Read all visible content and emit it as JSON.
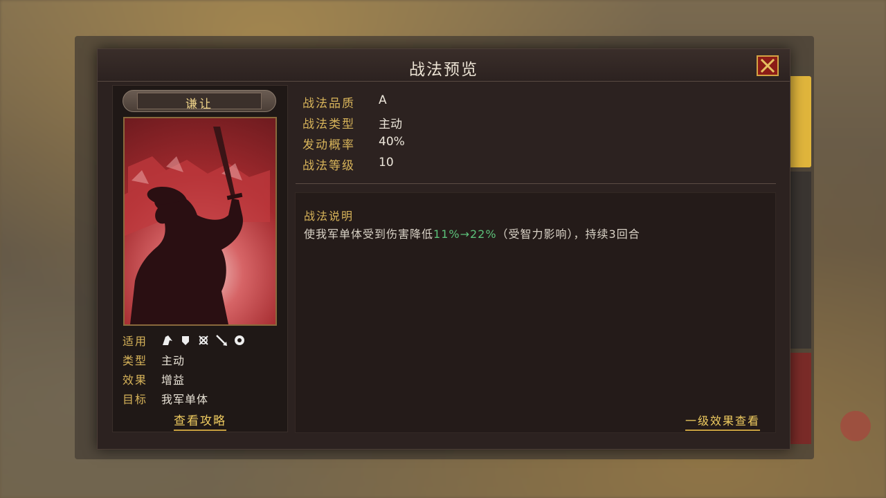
{
  "dialog": {
    "title": "战法预览"
  },
  "skill": {
    "name": "谦让",
    "portrait_icon": "warrior-silhouette-with-sword"
  },
  "left_info": {
    "applicable_label": "适用",
    "applicable_icons": [
      "cavalry-icon",
      "shield-icon",
      "crossbow-icon",
      "spear-icon",
      "siege-icon"
    ],
    "type_label": "类型",
    "type_value": "主动",
    "effect_label": "效果",
    "effect_value": "增益",
    "target_label": "目标",
    "target_value": "我军单体",
    "guide_link": "查看攻略"
  },
  "attributes": [
    {
      "label": "战法品质",
      "value": "A"
    },
    {
      "label": "战法类型",
      "value": "主动"
    },
    {
      "label": "发动概率",
      "value": "40%"
    },
    {
      "label": "战法等级",
      "value": "10"
    }
  ],
  "description": {
    "title": "战法说明",
    "text_before": "使我军单体受到伤害降低",
    "highlight_from": "11%",
    "arrow": "→",
    "highlight_to": "22%",
    "text_after": "（受智力影响），持续3回合",
    "highlight_color": "#5cc17a"
  },
  "effect_link": "一级效果查看",
  "colors": {
    "accent_gold": "#d8b45a",
    "close_red": "#8b1c17",
    "panel_dark": "#2c2220"
  }
}
